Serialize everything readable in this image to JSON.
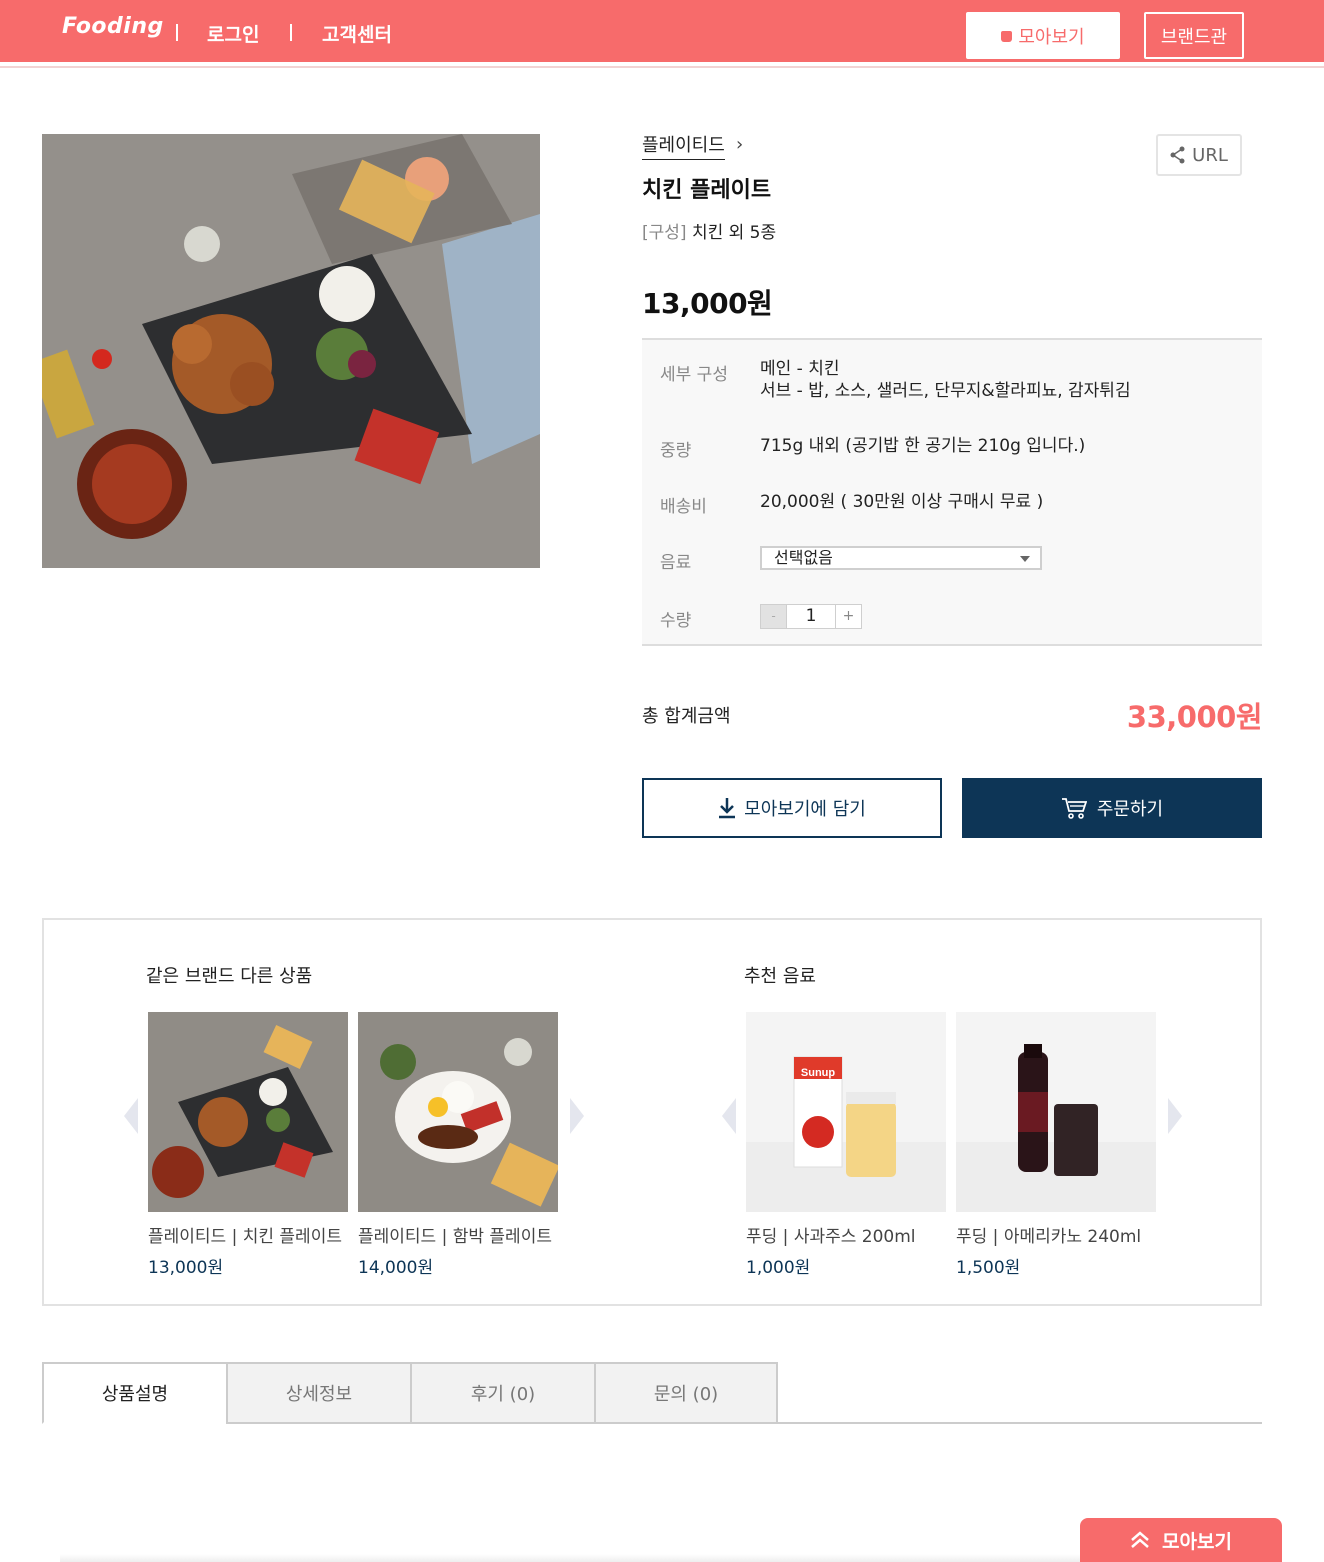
{
  "header": {
    "logo": "Fooding",
    "login": "로그인",
    "customer_center": "고객센터",
    "collect_button": "모아보기",
    "brand_button": "브랜드관",
    "accent": "#f76b6b"
  },
  "product": {
    "category": "플레이티드",
    "url_button": "URL",
    "title": "치킨 플레이트",
    "composition_tag": "[구성]",
    "composition": "치킨 외 5종",
    "price": "13,000원",
    "details": {
      "composition_label": "세부 구성",
      "composition_main": "메인 - 치킨",
      "composition_sub": "서브 - 밥, 소스, 샐러드, 단무지&할라피뇨, 감자튀김",
      "weight_label": "중량",
      "weight": "715g 내외 (공기밥 한 공기는 210g 입니다.)",
      "shipping_label": "배송비",
      "shipping": "20,000원 ( 30만원 이상 구매시 무료 )",
      "drink_label": "음료",
      "drink_selected": "선택없음",
      "qty_label": "수량",
      "qty_minus": "-",
      "qty_value": "1",
      "qty_plus": "+"
    },
    "total_label": "총 합계금액",
    "total": "33,000원",
    "add_button": "모아보기에 담기",
    "order_button": "주문하기",
    "navy": "#0d3556"
  },
  "recommend": {
    "same_brand_title": "같은 브랜드 다른 상품",
    "drinks_title": "추천 음료",
    "same_brand": [
      {
        "name": "플레이티드 | 치킨 플레이트",
        "price": "13,000원"
      },
      {
        "name": "플레이티드 | 함박 플레이트",
        "price": "14,000원"
      }
    ],
    "drinks": [
      {
        "name": "푸딩 | 사과주스 200ml",
        "price": "1,000원",
        "brand_label": "Sunup"
      },
      {
        "name": "푸딩 | 아메리카노 240ml",
        "price": "1,500원"
      }
    ]
  },
  "tabs": [
    "상품설명",
    "상세정보",
    "후기 (0)",
    "문의 (0)"
  ],
  "float_button": "모아보기"
}
